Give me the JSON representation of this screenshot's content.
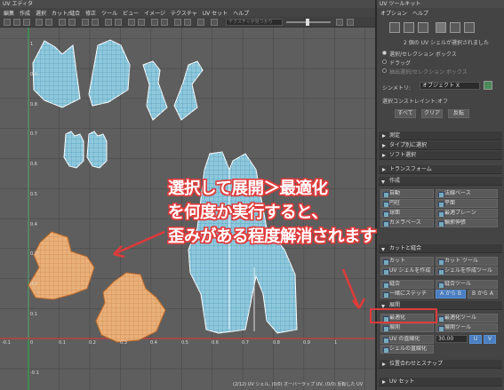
{
  "uv_editor": {
    "title": "UV エディタ",
    "menu": [
      "編集",
      "作成",
      "選択",
      "カット/縫合",
      "修正",
      "ツール",
      "ビュー",
      "イメージ",
      "テクスチャ",
      "UV セット",
      "ヘルプ"
    ],
    "search_placeholder": "テクスチャが見つかり",
    "axis_labels": {
      "top_1": "1",
      "left_09": "0.9",
      "left_08": "0.8",
      "left_07": "0.7",
      "left_06": "0.6",
      "left_05": "0.5",
      "left_04": "0.4",
      "left_03": "0.3",
      "left_02": "0.2",
      "left_01": "0.1",
      "origin": "0",
      "bottom_neg01": "-0.1",
      "neg01_x": "-0.1",
      "x01": "0.1",
      "x02": "0.2",
      "x03": "0.3",
      "x04": "0.4",
      "x05": "0.5",
      "x06": "0.6",
      "x07": "0.7",
      "x08": "0.8",
      "x09": "0.9",
      "x1": "1"
    },
    "status": "(2/12) UV シェル, (0/0) オーバーラップ UV, (0/0) 反転した UV"
  },
  "annotation": {
    "lines": [
      "選択して展開＞最適化",
      "を何度か実行すると、",
      "歪みがある程度解消されます"
    ],
    "color": "#e03a3a"
  },
  "toolkit": {
    "title": "UV ツールキット",
    "menu": [
      "オプション",
      "ヘルプ"
    ],
    "selection_info": "2 個の UV シェルが選択されました",
    "radio_options": [
      "選択/セレクション ボックス",
      "ドラッグ",
      "抽出選択/セレクション ボックス"
    ],
    "symmetry_label": "シンメトリ:",
    "symmetry_value": "オブジェクト X",
    "constraint_label": "選択コンストレイント:",
    "constraint_value": "オフ",
    "select_buttons": [
      "すべて",
      "クリア",
      "反転"
    ],
    "sections": {
      "measure": "測定",
      "select_by_type": "タイプ別に選択",
      "soft_select": "ソフト選択",
      "transform": "トランスフォーム",
      "create": "作成",
      "cut_sew": "カットと縫合",
      "unfold": "展開",
      "align": "位置合わせとスナップ",
      "uv_set": "UV セット"
    },
    "create_buttons": [
      "自動",
      "円柱",
      "球面",
      "カメラベース",
      "法線ベース",
      "平面",
      "最適プレーン",
      "輪郭伸張"
    ],
    "cut_buttons": [
      "カット",
      "カット ツール",
      "UV シェルを作成",
      "シェルを作成ツール",
      "縫合",
      "縫合ツール",
      "一緒にステッチ"
    ],
    "stitch_options": [
      "A から B",
      "B から A"
    ],
    "unfold_buttons": [
      "最適化",
      "最適化ツール",
      "展開",
      "展開ツール",
      "UV の直線化",
      "シェルの直線化"
    ],
    "unfold_value": "30.00",
    "uv_buttons": [
      "U",
      "V"
    ],
    "accent_blue": "#4a7fc1"
  }
}
